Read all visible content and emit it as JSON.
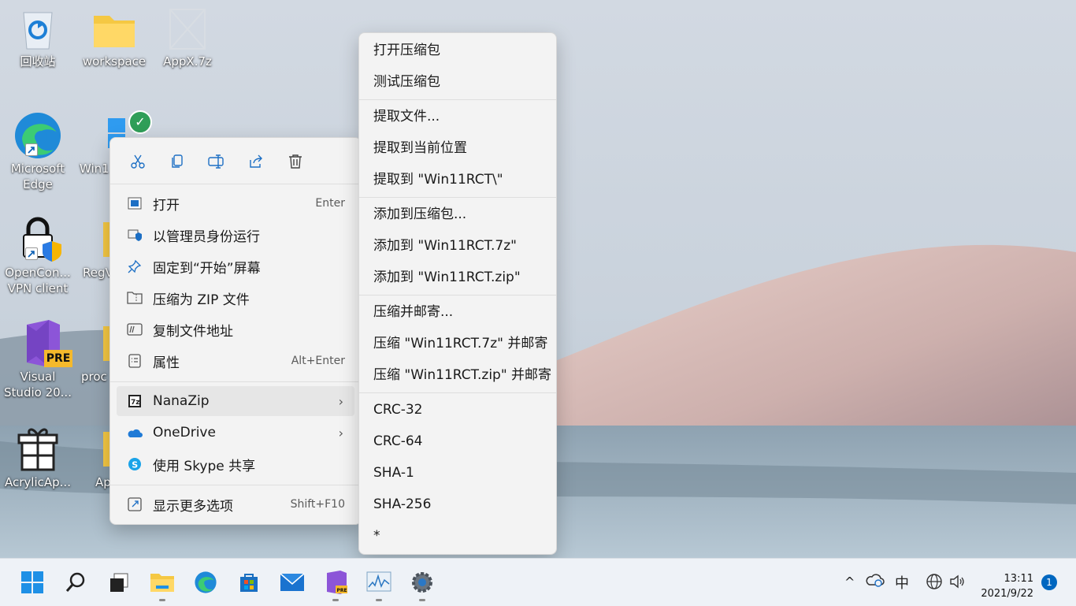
{
  "desktop": {
    "icons": [
      {
        "label": "回收站",
        "icon": "recycle-bin-icon"
      },
      {
        "label": "workspace",
        "icon": "folder-icon"
      },
      {
        "label": "AppX.7z",
        "icon": "archive-file-icon"
      },
      {
        "label": "Microsoft\nEdge",
        "icon": "edge-icon"
      },
      {
        "label": "Win1",
        "icon": "windows-folder-icon"
      },
      {
        "label": "OpenCon...\nVPN client",
        "icon": "openvpn-icon"
      },
      {
        "label": "RegV",
        "icon": "folder-icon"
      },
      {
        "label": "Visual\nStudio 20...",
        "icon": "visual-studio-icon"
      },
      {
        "label": "proc",
        "icon": "folder-icon"
      },
      {
        "label": "AcrylicAp...",
        "icon": "gift-box-icon"
      },
      {
        "label": "Ap",
        "icon": "folder-icon"
      }
    ]
  },
  "context_menu": {
    "toolbar": [
      "cut-icon",
      "copy-icon",
      "rename-icon",
      "share-icon",
      "delete-icon"
    ],
    "items": [
      {
        "label": "打开",
        "accelerator": "Enter"
      },
      {
        "label": "以管理员身份运行",
        "accelerator": ""
      },
      {
        "label": "固定到“开始”屏幕",
        "accelerator": ""
      },
      {
        "label": "压缩为 ZIP 文件",
        "accelerator": ""
      },
      {
        "label": "复制文件地址",
        "accelerator": ""
      },
      {
        "label": "属性",
        "accelerator": "Alt+Enter"
      },
      {
        "label": "NanaZip",
        "accelerator": ""
      },
      {
        "label": "OneDrive",
        "accelerator": ""
      },
      {
        "label": "使用 Skype 共享",
        "accelerator": ""
      },
      {
        "label": "显示更多选项",
        "accelerator": "Shift+F10"
      }
    ]
  },
  "submenu": {
    "items": [
      "打开压缩包",
      "测试压缩包",
      "提取文件...",
      "提取到当前位置",
      "提取到 \"Win11RCT\\\"",
      "添加到压缩包...",
      "添加到 \"Win11RCT.7z\"",
      "添加到 \"Win11RCT.zip\"",
      "压缩并邮寄...",
      "压缩 \"Win11RCT.7z\" 并邮寄",
      "压缩 \"Win11RCT.zip\" 并邮寄",
      "CRC-32",
      "CRC-64",
      "SHA-1",
      "SHA-256",
      "*"
    ]
  },
  "taskbar": {
    "apps": [
      "start-icon",
      "search-icon",
      "task-view-icon",
      "file-explorer-icon",
      "edge-icon",
      "store-icon",
      "mail-icon",
      "visual-studio-icon",
      "performance-monitor-icon",
      "settings-icon"
    ],
    "tray": {
      "chevron": "^",
      "ime": "中",
      "time": "13:11",
      "date": "2021/9/22",
      "notifications": "1"
    }
  },
  "colors": {
    "accent": "#0067c0",
    "menu_bg": "#f3f3f3"
  }
}
